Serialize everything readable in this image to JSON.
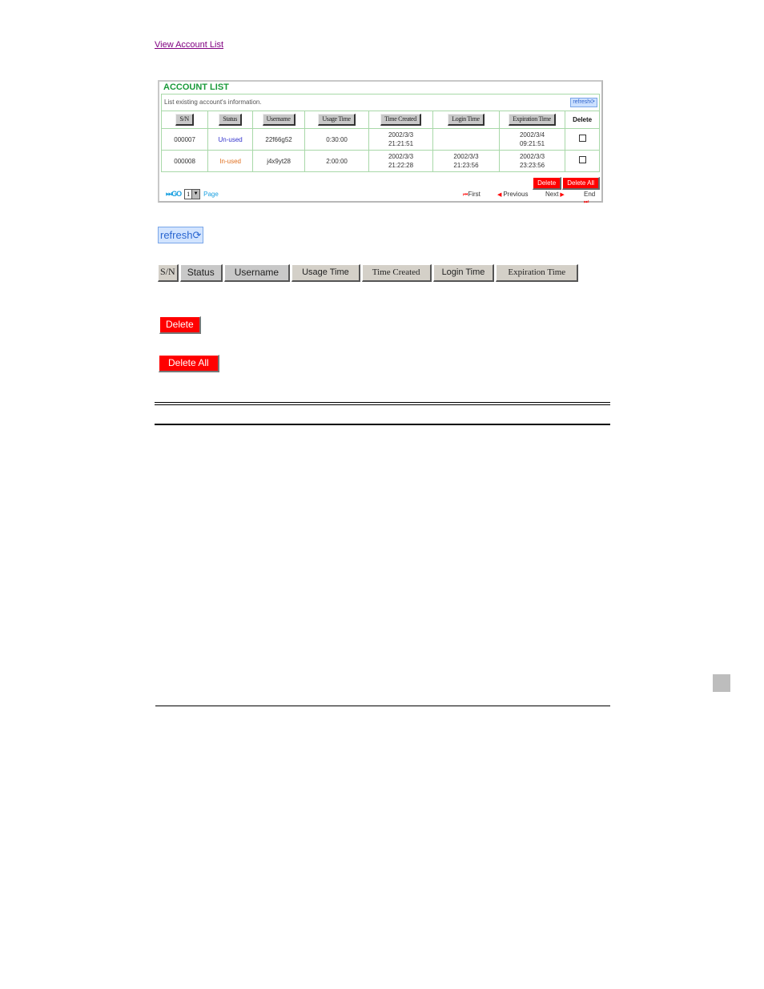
{
  "link": {
    "view_account_list": "View Account List"
  },
  "panel": {
    "title": "ACCOUNT LIST",
    "description": "List existing account's information.",
    "refresh_label": "refresh",
    "columns": [
      "S/N",
      "Status",
      "Username",
      "Usage Time",
      "Time Created",
      "Login Time",
      "Expiration Time",
      "Delete"
    ],
    "rows": [
      {
        "sn": "000007",
        "status": "Un-used",
        "username": "22f66g52",
        "usage_time": "0:30:00",
        "created_date": "2002/3/3",
        "created_time": "21:21:51",
        "login_date": "",
        "login_time": "",
        "exp_date": "2002/3/4",
        "exp_time": "09:21:51",
        "checked": false
      },
      {
        "sn": "000008",
        "status": "In-used",
        "username": "j4x9yt28",
        "usage_time": "2:00:00",
        "created_date": "2002/3/3",
        "created_time": "21:22:28",
        "login_date": "2002/3/3",
        "login_time": "21:23:56",
        "exp_date": "2002/3/3",
        "exp_time": "23:23:56",
        "checked": false
      }
    ],
    "delete_label": "Delete",
    "delete_all_label": "Delete All",
    "go_label": "GO",
    "page_value": "1",
    "page_label": "Page",
    "nav": {
      "first": "First",
      "previous": "Previous",
      "next": "Next",
      "end": "End"
    }
  },
  "illustrations": {
    "refresh_label": "refresh",
    "headers": [
      "S/N",
      "Status",
      "Username",
      "Usage Time",
      "Time Created",
      "Login Time",
      "Expiration Time"
    ],
    "delete_label": "Delete",
    "delete_all_label": "Delete All"
  },
  "colors": {
    "title_green": "#1a9a3a",
    "unused_blue": "#3333cc",
    "inused_orange": "#e07020",
    "delete_red": "#ff0000",
    "link_purple": "#800080"
  }
}
